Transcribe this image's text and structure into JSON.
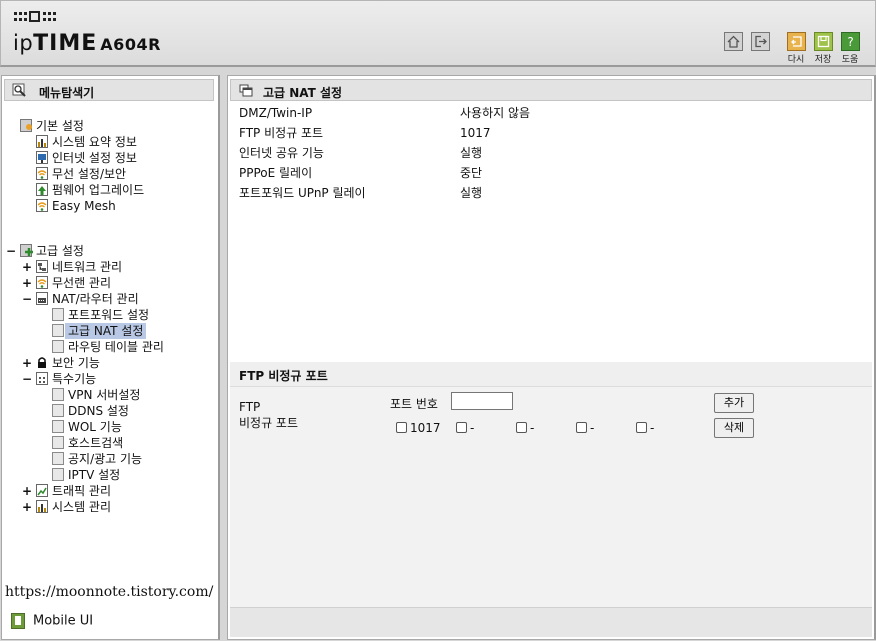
{
  "header": {
    "brand_prefix": "ip",
    "brand_bold": "TIME",
    "model": "A604R",
    "buttons": [
      {
        "name": "home",
        "label": ""
      },
      {
        "name": "logout",
        "label": ""
      },
      {
        "name": "retry",
        "label": "다시"
      },
      {
        "name": "save",
        "label": "저장"
      },
      {
        "name": "help",
        "label": "도움"
      }
    ]
  },
  "left": {
    "title": "메뉴탐색기",
    "tree": [
      {
        "toggle": "",
        "label": "기본 설정",
        "icon": "folder"
      },
      {
        "toggle": "",
        "label": "시스템 요약 정보",
        "icon": "chart"
      },
      {
        "toggle": "",
        "label": "인터넷 설정 정보",
        "icon": "monitor"
      },
      {
        "toggle": "",
        "label": "무선 설정/보안",
        "icon": "wifi"
      },
      {
        "toggle": "",
        "label": "펌웨어 업그레이드",
        "icon": "upgrade"
      },
      {
        "toggle": "",
        "label": "Easy Mesh",
        "icon": "wifi"
      },
      {
        "toggle": "−",
        "label": "고급 설정",
        "icon": "folder-plus"
      },
      {
        "toggle": "+",
        "label": "네트워크 관리",
        "icon": "network"
      },
      {
        "toggle": "+",
        "label": "무선랜 관리",
        "icon": "wifi"
      },
      {
        "toggle": "−",
        "label": "NAT/라우터 관리",
        "icon": "router"
      },
      {
        "toggle": "",
        "label": "포트포워드 설정",
        "icon": "page"
      },
      {
        "toggle": "",
        "label": "고급 NAT 설정",
        "icon": "page"
      },
      {
        "toggle": "",
        "label": "라우팅 테이블 관리",
        "icon": "page"
      },
      {
        "toggle": "+",
        "label": "보안 기능",
        "icon": "lock"
      },
      {
        "toggle": "−",
        "label": "특수기능",
        "icon": "special"
      },
      {
        "toggle": "",
        "label": "VPN 서버설정",
        "icon": "page"
      },
      {
        "toggle": "",
        "label": "DDNS 설정",
        "icon": "page"
      },
      {
        "toggle": "",
        "label": "WOL 기능",
        "icon": "page"
      },
      {
        "toggle": "",
        "label": "호스트검색",
        "icon": "page"
      },
      {
        "toggle": "",
        "label": "공지/광고 기능",
        "icon": "page"
      },
      {
        "toggle": "",
        "label": "IPTV 설정",
        "icon": "page"
      },
      {
        "toggle": "+",
        "label": "트래픽 관리",
        "icon": "traffic"
      },
      {
        "toggle": "+",
        "label": "시스템 관리",
        "icon": "chart"
      }
    ],
    "blog_link": "https://moonnote.tistory.com/",
    "mobile_ui": "Mobile UI"
  },
  "main": {
    "title": "고급 NAT 설정",
    "rows": [
      {
        "key": "DMZ/Twin-IP",
        "value": "사용하지 않음"
      },
      {
        "key": "FTP 비정규 포트",
        "value": "1017"
      },
      {
        "key": "인터넷 공유 기능",
        "value": "실행"
      },
      {
        "key": "PPPoE 릴레이",
        "value": "중단"
      },
      {
        "key": "포트포워드 UPnP 릴레이",
        "value": "실행"
      }
    ],
    "ftp": {
      "section_title": "FTP 비정규 포트",
      "label_line1": "FTP",
      "label_line2": "비정규 포트",
      "port_label": "포트 번호",
      "port_value": "",
      "add_button": "추가",
      "delete_button": "삭제",
      "ports": [
        "1017",
        "-",
        "-",
        "-",
        "-"
      ]
    }
  },
  "colors": {
    "selected_row": "#c8d5ea",
    "tree_selected": "#b9c8e4",
    "retry_btn": "#e8b24c",
    "save_btn": "#9fc24a",
    "help_btn": "#4a9a3a"
  }
}
